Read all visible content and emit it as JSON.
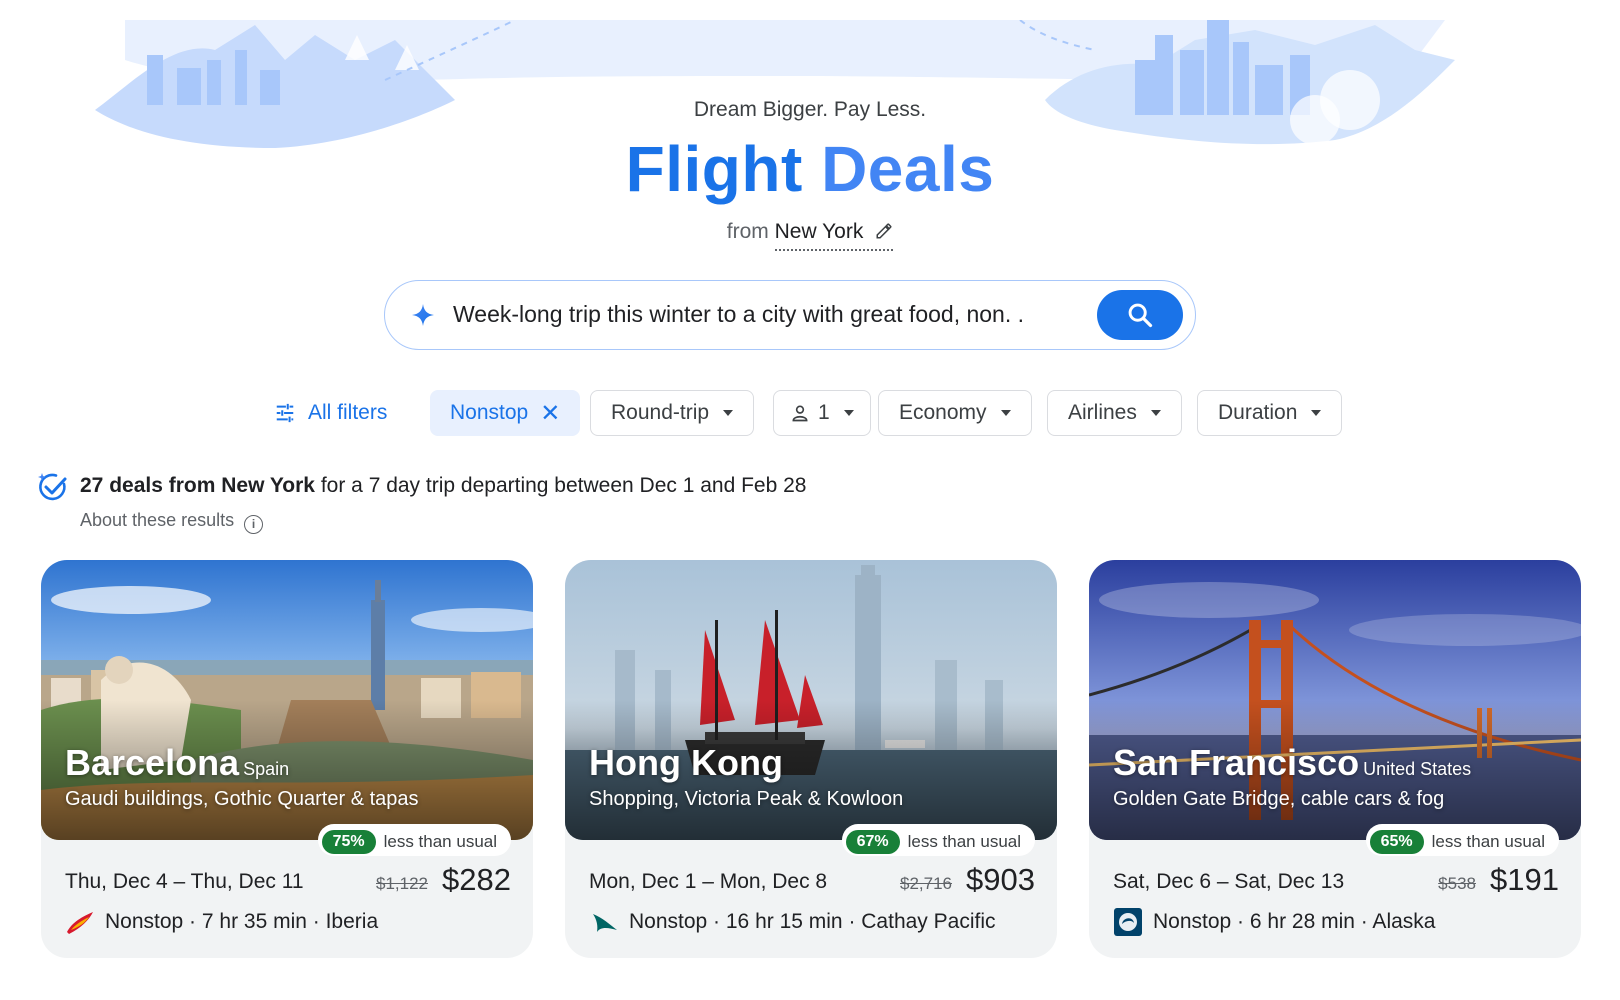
{
  "header": {
    "tagline": "Dream Bigger. Pay Less.",
    "title_part1": "Flight",
    "title_part2": "Deals",
    "from_label": "from",
    "origin_city": "New York",
    "edit_icon": "pencil-icon"
  },
  "search": {
    "query": "Week-long trip this winter to a city with great food, non. .",
    "sparkle_icon": "sparkle-icon",
    "button_icon": "search-icon"
  },
  "filters": {
    "all_filters": "All filters",
    "nonstop": "Nonstop",
    "trip_type": "Round-trip",
    "passengers": "1",
    "cabin": "Economy",
    "airlines": "Airlines",
    "duration": "Duration"
  },
  "summary": {
    "count_text": "27 deals from New York",
    "rest_text": " for a 7 day trip departing between Dec 1 and Feb 28",
    "about": "About these results"
  },
  "colors": {
    "accent": "#1a73e8",
    "deal_green": "#188038",
    "card_bg": "#f1f3f4"
  },
  "deals": [
    {
      "city": "Barcelona",
      "country": "Spain",
      "highlights": "Gaudi buildings, Gothic Quarter & tapas",
      "discount": "75%",
      "less_than_usual": "less than usual",
      "dates": "Thu, Dec 4 – Thu, Dec 11",
      "old_price": "$1,122",
      "price": "$282",
      "flight_info": "Nonstop · 7 hr 35 min · Iberia",
      "airline_icon": "iberia-logo-icon"
    },
    {
      "city": "Hong Kong",
      "country": "",
      "highlights": "Shopping, Victoria Peak & Kowloon",
      "discount": "67%",
      "less_than_usual": "less than usual",
      "dates": "Mon, Dec 1 – Mon, Dec 8",
      "old_price": "$2,716",
      "price": "$903",
      "flight_info": "Nonstop · 16 hr 15 min · Cathay Pacific",
      "airline_icon": "cathay-pacific-logo-icon"
    },
    {
      "city": "San Francisco",
      "country": "United States",
      "highlights": "Golden Gate Bridge, cable cars & fog",
      "discount": "65%",
      "less_than_usual": "less than usual",
      "dates": "Sat, Dec 6 – Sat, Dec 13",
      "old_price": "$538",
      "price": "$191",
      "flight_info": "Nonstop · 6 hr 28 min · Alaska",
      "airline_icon": "alaska-logo-icon"
    }
  ]
}
